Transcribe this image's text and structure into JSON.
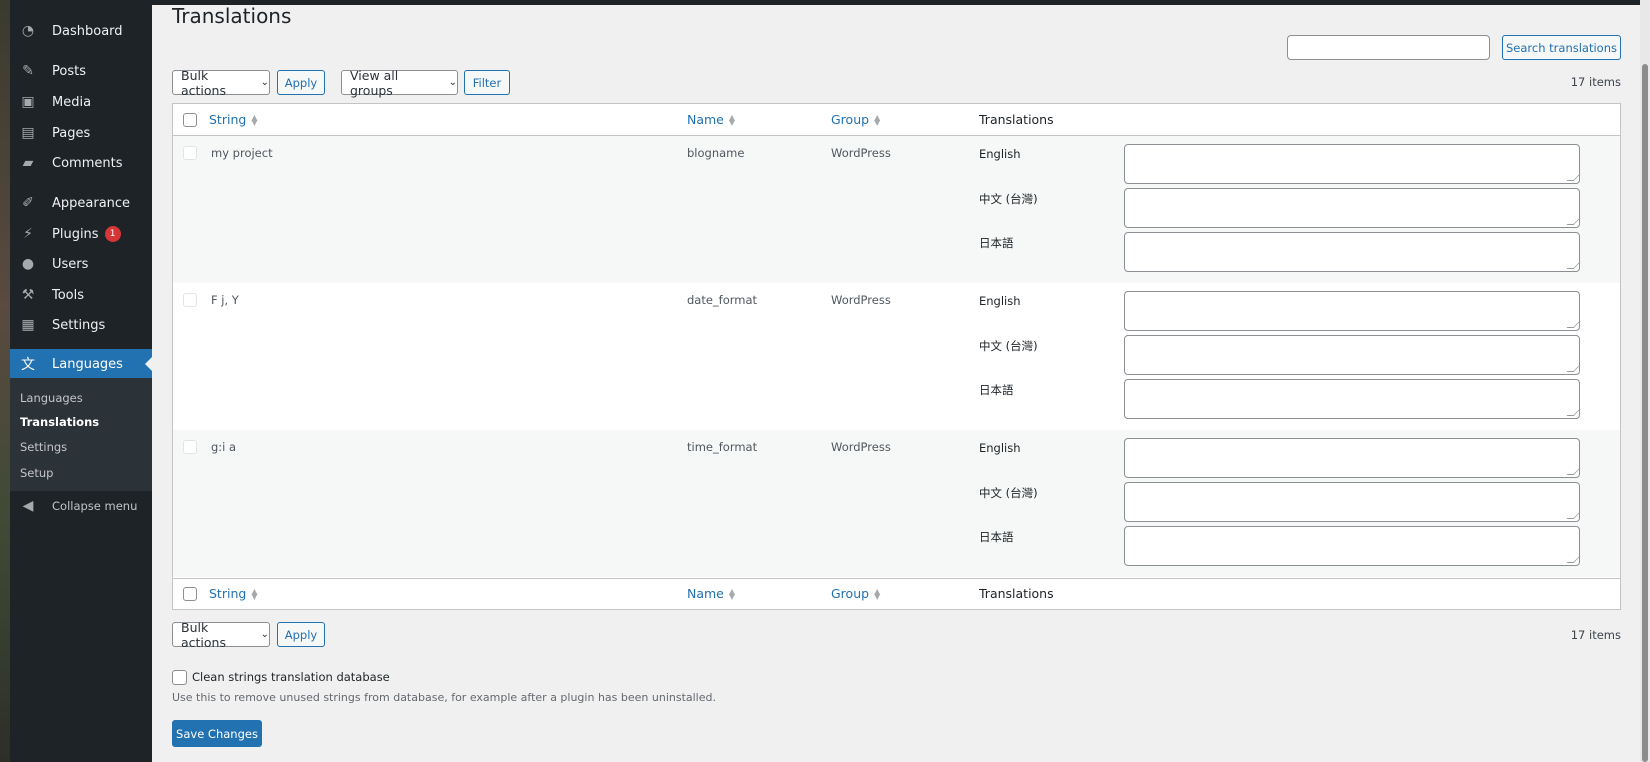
{
  "sidebar": {
    "items": [
      {
        "label": "Dashboard",
        "icon": "dashboard-icon"
      },
      {
        "label": "Posts",
        "icon": "pin-icon"
      },
      {
        "label": "Media",
        "icon": "media-icon"
      },
      {
        "label": "Pages",
        "icon": "pages-icon"
      },
      {
        "label": "Comments",
        "icon": "comment-icon"
      },
      {
        "label": "Appearance",
        "icon": "brush-icon"
      },
      {
        "label": "Plugins",
        "icon": "plugin-icon",
        "badge": "1"
      },
      {
        "label": "Users",
        "icon": "user-icon"
      },
      {
        "label": "Tools",
        "icon": "wrench-icon"
      },
      {
        "label": "Settings",
        "icon": "settings-icon"
      },
      {
        "label": "Languages",
        "icon": "translate-icon"
      }
    ],
    "submenu": [
      "Languages",
      "Translations",
      "Settings",
      "Setup"
    ],
    "collapse": "Collapse menu"
  },
  "page": {
    "title": "Translations"
  },
  "search": {
    "value": "",
    "button": "Search translations"
  },
  "toolbar": {
    "bulk": "Bulk actions",
    "apply": "Apply",
    "groups": "View all groups",
    "filter": "Filter",
    "count": "17 items"
  },
  "table": {
    "headers": {
      "string": "String",
      "name": "Name",
      "group": "Group",
      "translations": "Translations"
    },
    "rows": [
      {
        "string": "my project",
        "name": "blogname",
        "group": "WordPress"
      },
      {
        "string": "F j, Y",
        "name": "date_format",
        "group": "WordPress"
      },
      {
        "string": "g:i a",
        "name": "time_format",
        "group": "WordPress"
      }
    ],
    "languages": [
      "English",
      "中文 (台灣)",
      "日本語"
    ]
  },
  "footer": {
    "clean_label": "Clean strings translation database",
    "clean_desc": "Use this to remove unused strings from database, for example after a plugin has been uninstalled.",
    "save": "Save Changes"
  },
  "colors": {
    "accent": "#2271b1",
    "sidebar": "#1d2327",
    "badge": "#d63638"
  }
}
